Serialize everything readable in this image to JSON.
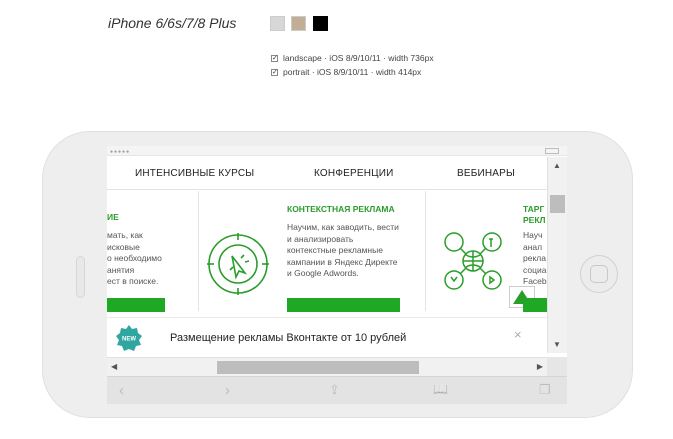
{
  "header": {
    "device_title": "iPhone 6/6s/7/8 Plus",
    "swatches": [
      "#d7d7d7",
      "#c2ae94",
      "#000000"
    ],
    "options": [
      {
        "label": "landscape · iOS 8/9/10/11 · width 736px",
        "checked": true
      },
      {
        "label": "portrait · iOS 8/9/10/11 · width 414px",
        "checked": true
      }
    ]
  },
  "site": {
    "nav": [
      "ИНТЕНСИВНЫЕ КУРСЫ",
      "КОНФЕРЕНЦИИ",
      "ВЕБИНАРЫ"
    ],
    "cards": [
      {
        "title": "ИЕ",
        "desc": [
          "мать, как",
          "исковые",
          "о необходимо",
          "анятия",
          "ест в поиске."
        ]
      },
      {
        "title": "КОНТЕКСТНАЯ РЕКЛАМА",
        "desc": [
          "Научим, как заводить, вести",
          "и анализировать",
          "контекстные рекламные",
          "кампании в Яндекс Директе",
          "и Google Adwords."
        ]
      },
      {
        "title": "ТАРГ\nРЕКЛ",
        "desc": [
          "Науч",
          "анал",
          "рекла",
          "социа",
          "Faceb"
        ]
      }
    ],
    "banner": {
      "badge": "NEW",
      "text": "Размещение рекламы Вконтакте от 10 рублей",
      "close": "×"
    }
  },
  "browser": {
    "status_dots": "●●●●●",
    "scroll_up": "▲",
    "scroll_down": "▼",
    "scroll_left": "◀",
    "scroll_right": "▶",
    "toolbar": {
      "back": "‹",
      "forward": "›",
      "share": "⇪",
      "bookmarks": "📖",
      "tabs": "❐"
    }
  },
  "colors": {
    "accent": "#1fa823",
    "title_green": "#2a9d2a"
  }
}
